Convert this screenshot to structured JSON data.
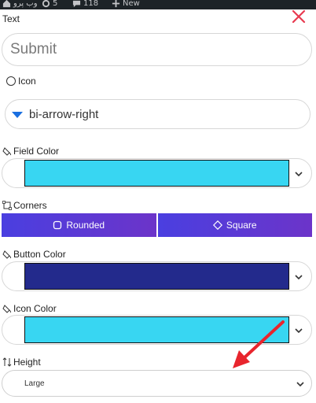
{
  "adminbar": {
    "site_name": "وب پرو",
    "updates_count": "5",
    "comments_count": "118",
    "new_label": "New"
  },
  "text_field": {
    "label": "Text",
    "value": "Submit"
  },
  "icon": {
    "label": "Icon",
    "value": "bi-arrow-right"
  },
  "field_color": {
    "label": "Field Color",
    "color": "#38d6f2"
  },
  "corners": {
    "label": "Corners",
    "options": [
      "Rounded",
      "Square"
    ]
  },
  "button_color": {
    "label": "Button Color",
    "color": "#232a8c"
  },
  "icon_color": {
    "label": "Icon Color",
    "color": "#38d6f2"
  },
  "height": {
    "label": "Height",
    "value": "Large"
  },
  "colors": {
    "accent": "#5b3ad6",
    "close": "#e8394f",
    "annotation_arrow": "#e8252d"
  }
}
